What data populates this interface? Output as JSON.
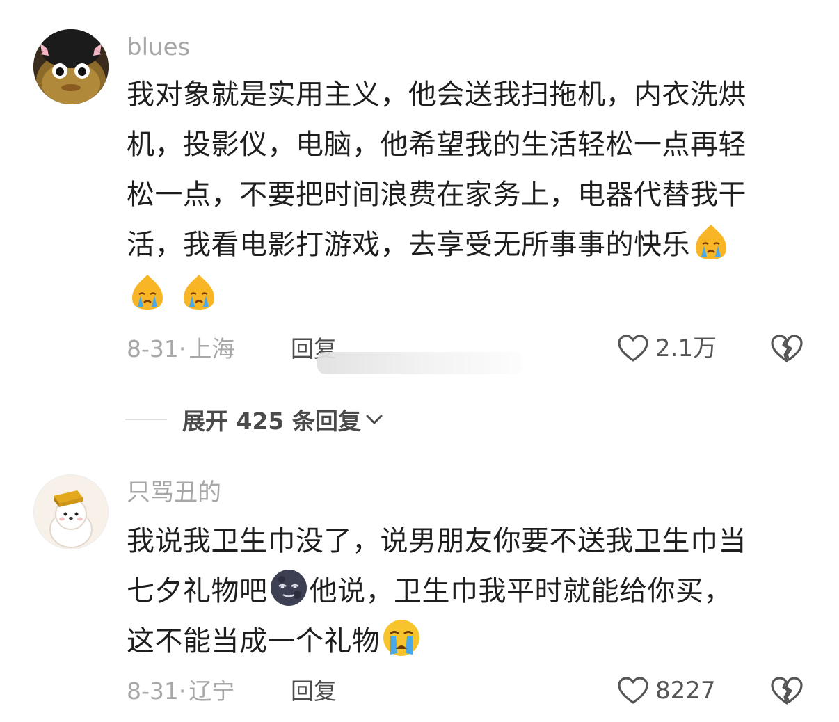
{
  "comments": [
    {
      "username": "blues",
      "lines": [
        "我对象就是实用主义，他会送我扫拖机，内衣洗烘",
        "机，投影仪，电脑，他希望我的生活轻松一点再轻",
        "松一点，不要把时间浪费在家务上，电器代替我干",
        "活，我看电影打游戏，去享受无所事事的快乐"
      ],
      "trailing_emoji": "crying-chick-emoji",
      "date": "8-31",
      "location": "上海",
      "reply_label": "回复",
      "like_count": "2.1万",
      "expand_label": "展开 425 条回复"
    },
    {
      "username": "只骂丑的",
      "line1": "我说我卫生巾没了，说男朋友你要不送我卫生巾当",
      "line2_a": "七夕礼物吧",
      "line2_b": "他说，卫生巾我平时就能给你买，",
      "line3": "这不能当成一个礼物",
      "date": "8-31",
      "location": "辽宁",
      "reply_label": "回复",
      "like_count": "8227"
    }
  ],
  "meta_separator": "·",
  "colors": {
    "username": "#a7a7a7",
    "meta": "#a8a8a8",
    "body_text": "#1e1e1e",
    "icon_stroke": "#555555"
  }
}
